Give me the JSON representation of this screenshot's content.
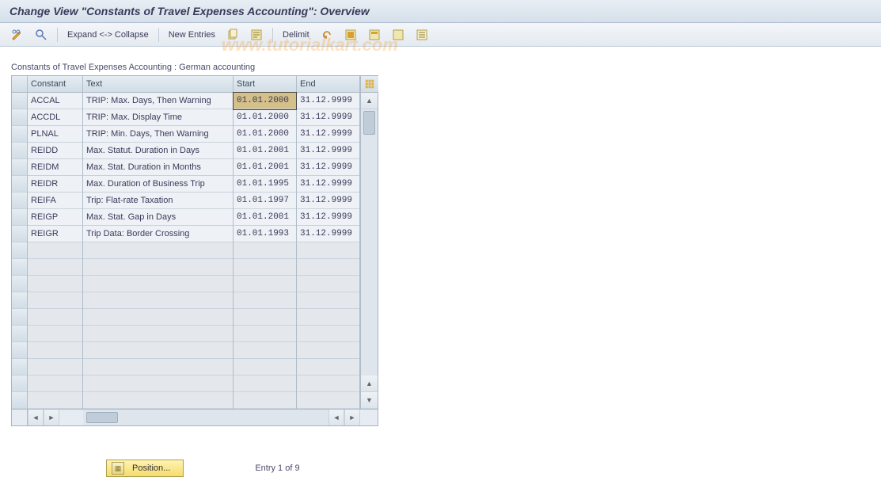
{
  "title": "Change View \"Constants of Travel Expenses Accounting\": Overview",
  "toolbar": {
    "expand": "Expand <-> Collapse",
    "new_entries": "New Entries",
    "delimit": "Delimit"
  },
  "watermark": "www.tutorialkart.com",
  "subtitle": "Constants of Travel Expenses Accounting : German accounting",
  "columns": {
    "constant": "Constant",
    "text": "Text",
    "start": "Start",
    "end": "End"
  },
  "rows": [
    {
      "constant": "ACCAL",
      "text": "TRIP: Max. Days, Then Warning",
      "start": "01.01.2000",
      "end": "31.12.9999"
    },
    {
      "constant": "ACCDL",
      "text": "TRIP: Max. Display Time",
      "start": "01.01.2000",
      "end": "31.12.9999"
    },
    {
      "constant": "PLNAL",
      "text": "TRIP: Min. Days, Then Warning",
      "start": "01.01.2000",
      "end": "31.12.9999"
    },
    {
      "constant": "REIDD",
      "text": "Max. Statut. Duration in Days",
      "start": "01.01.2001",
      "end": "31.12.9999"
    },
    {
      "constant": "REIDM",
      "text": "Max. Stat. Duration in Months",
      "start": "01.01.2001",
      "end": "31.12.9999"
    },
    {
      "constant": "REIDR",
      "text": "Max. Duration of Business Trip",
      "start": "01.01.1995",
      "end": "31.12.9999"
    },
    {
      "constant": "REIFA",
      "text": "Trip: Flat-rate Taxation",
      "start": "01.01.1997",
      "end": "31.12.9999"
    },
    {
      "constant": "REIGP",
      "text": "Max. Stat. Gap in Days",
      "start": "01.01.2001",
      "end": "31.12.9999"
    },
    {
      "constant": "REIGR",
      "text": "Trip Data: Border Crossing",
      "start": "01.01.1993",
      "end": "31.12.9999"
    }
  ],
  "empty_rows": 10,
  "selected": {
    "row": 0,
    "col": "start"
  },
  "footer": {
    "position_btn": "Position...",
    "entry_text": "Entry 1 of 9"
  }
}
